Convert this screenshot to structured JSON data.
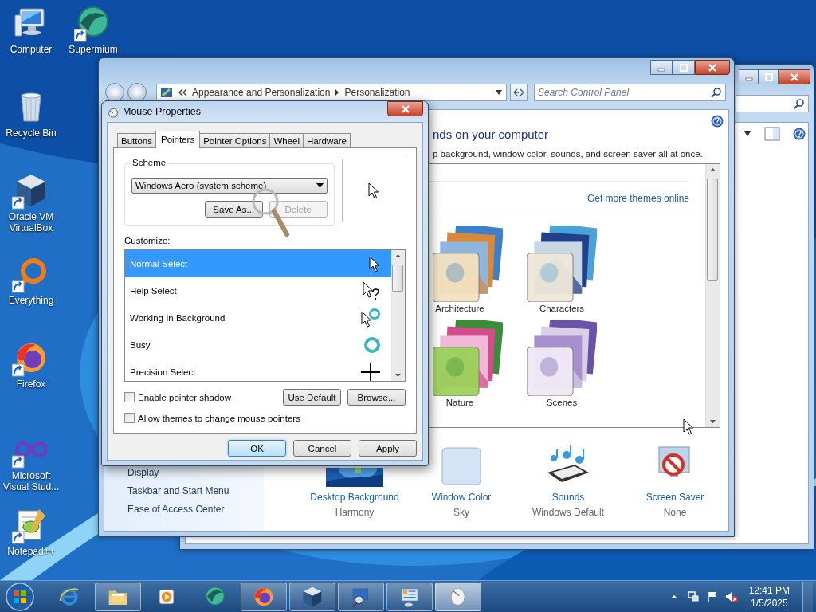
{
  "desktop_icons": [
    {
      "label": "Computer",
      "kind": "computer",
      "shortcut": false
    },
    {
      "label": "Supermium",
      "kind": "supermium",
      "shortcut": true
    },
    {
      "label": "Recycle Bin",
      "kind": "recycle",
      "shortcut": false
    },
    {
      "label": "Oracle VM VirtualBox",
      "kind": "virtualbox",
      "shortcut": true
    },
    {
      "label": "Everything",
      "kind": "everything",
      "shortcut": true
    },
    {
      "label": "Firefox",
      "kind": "firefox",
      "shortcut": true
    },
    {
      "label": "Microsoft Visual Stud...",
      "kind": "visualstudio",
      "shortcut": true
    },
    {
      "label": "Notepad++",
      "kind": "notepad",
      "shortcut": true
    }
  ],
  "control_panel": {
    "breadcrumb": [
      "Appearance and Personalization",
      "Personalization"
    ],
    "search_placeholder": "Search Control Panel",
    "heading": "nds on your computer",
    "subheading": "p background, window color, sounds, and screen saver all at once.",
    "more_themes_link": "Get more themes online",
    "themes": [
      {
        "label": "Architecture",
        "kind": "picture"
      },
      {
        "label": "Characters",
        "kind": "picture"
      },
      {
        "label": "Nature",
        "kind": "picture"
      },
      {
        "label": "Scenes",
        "kind": "picture"
      }
    ],
    "see_also": [
      "Display",
      "Taskbar and Start Menu",
      "Ease of Access Center"
    ],
    "settings": [
      {
        "label": "Desktop Background",
        "value": "Harmony",
        "kind": "background"
      },
      {
        "label": "Window Color",
        "value": "Sky",
        "kind": "color"
      },
      {
        "label": "Sounds",
        "value": "Windows Default",
        "kind": "sounds"
      },
      {
        "label": "Screen Saver",
        "value": "None",
        "kind": "screensaver"
      }
    ]
  },
  "mouse_dialog": {
    "title": "Mouse Properties",
    "tabs": [
      {
        "label": "Buttons",
        "selected": false
      },
      {
        "label": "Pointers",
        "selected": true
      },
      {
        "label": "Pointer Options",
        "selected": false
      },
      {
        "label": "Wheel",
        "selected": false
      },
      {
        "label": "Hardware",
        "selected": false
      }
    ],
    "scheme_label": "Scheme",
    "scheme_value": "Windows Aero (system scheme)",
    "scheme_buttons": [
      {
        "label": "Save As...",
        "disabled": false
      },
      {
        "label": "Delete",
        "disabled": true
      }
    ],
    "customize_label": "Customize:",
    "pointers": [
      {
        "label": "Normal Select",
        "kind": "arrow",
        "selected": true
      },
      {
        "label": "Help Select",
        "kind": "help",
        "selected": false
      },
      {
        "label": "Working In Background",
        "kind": "working",
        "selected": false
      },
      {
        "label": "Busy",
        "kind": "busy",
        "selected": false
      },
      {
        "label": "Precision Select",
        "kind": "cross",
        "selected": false
      }
    ],
    "checkboxes": [
      {
        "label": "Enable pointer shadow",
        "checked": false
      },
      {
        "label": "Allow themes to change mouse pointers",
        "checked": false
      }
    ],
    "list_buttons": [
      "Use Default",
      "Browse..."
    ],
    "buttons": [
      {
        "label": "OK",
        "default": true
      },
      {
        "label": "Cancel",
        "default": false
      },
      {
        "label": "Apply",
        "default": false
      }
    ]
  },
  "taskbar": {
    "apps": [
      {
        "kind": "ie",
        "running": false,
        "selected": false
      },
      {
        "kind": "folder",
        "running": true,
        "selected": false
      },
      {
        "kind": "media",
        "running": false,
        "selected": false
      },
      {
        "kind": "supermium",
        "running": false,
        "selected": false
      },
      {
        "kind": "firefox",
        "running": true,
        "selected": false
      },
      {
        "kind": "virtualbox",
        "running": true,
        "selected": false
      },
      {
        "kind": "magnifier",
        "running": true,
        "selected": false
      },
      {
        "kind": "controlpanel",
        "running": true,
        "selected": false
      },
      {
        "kind": "mouse",
        "running": true,
        "selected": true
      }
    ],
    "time": "12:41 PM",
    "date": "1/5/2025"
  }
}
